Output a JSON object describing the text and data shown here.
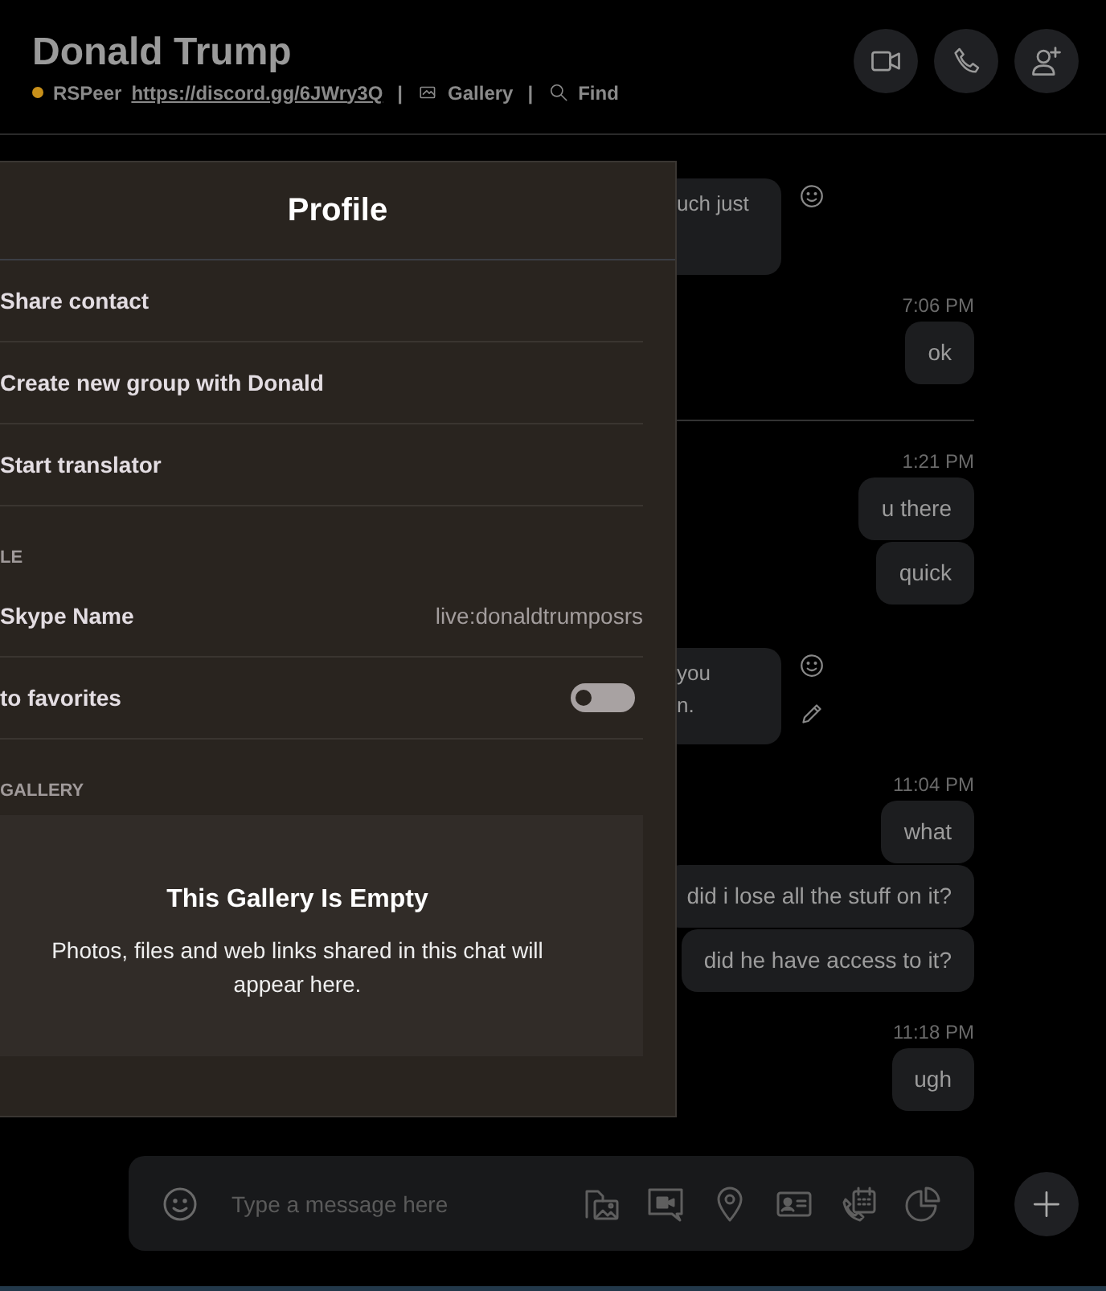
{
  "header": {
    "title": "Donald Trump",
    "status": "RSPeer",
    "link": "https://discord.gg/6JWry3Q",
    "separator": "|",
    "gallery": "Gallery",
    "find": "Find"
  },
  "messages": [
    {
      "kind": "incoming",
      "lines": [
        "uch just"
      ],
      "edited": false
    },
    {
      "kind": "time",
      "text": "7:06 PM"
    },
    {
      "kind": "outgoing",
      "text": "ok"
    },
    {
      "kind": "divider"
    },
    {
      "kind": "time",
      "text": "1:21 PM"
    },
    {
      "kind": "outgoing",
      "text": "u there"
    },
    {
      "kind": "outgoing",
      "text": "quick"
    },
    {
      "kind": "incoming",
      "lines": [
        "you",
        "n."
      ],
      "edited": true
    },
    {
      "kind": "time",
      "text": "11:04 PM"
    },
    {
      "kind": "outgoing",
      "text": "what"
    },
    {
      "kind": "outgoing",
      "text": "did i lose all the stuff on it?"
    },
    {
      "kind": "outgoing",
      "text": "did he have access to it?"
    },
    {
      "kind": "time",
      "text": "11:18 PM"
    },
    {
      "kind": "outgoing",
      "text": "ugh"
    }
  ],
  "profile": {
    "title": "Profile",
    "actions": [
      "Share contact",
      "Create new group with Donald",
      "Start translator"
    ],
    "section_label": "LE",
    "fields": [
      {
        "kind": "text",
        "label": "Skype Name",
        "value": "live:donaldtrumposrs"
      },
      {
        "kind": "toggle",
        "label": "to favorites",
        "on": false
      }
    ],
    "gallery": {
      "label": "GALLERY",
      "title": "This Gallery Is Empty",
      "text": "Photos, files and web links shared in this chat will appear here."
    }
  },
  "composer": {
    "placeholder": "Type a message here"
  }
}
